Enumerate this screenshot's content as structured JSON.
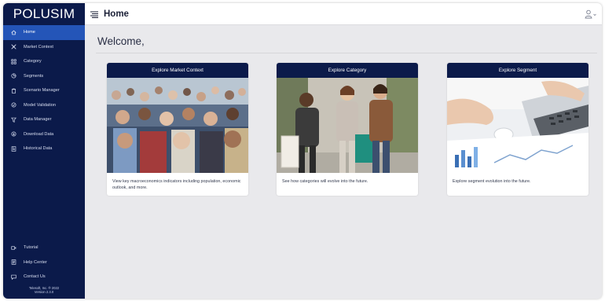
{
  "app": {
    "logo": "POLUSIM"
  },
  "header": {
    "title": "Home"
  },
  "sidebar": {
    "items": [
      {
        "label": "Home",
        "icon": "home-icon",
        "active": true
      },
      {
        "label": "Market Context",
        "icon": "market-icon"
      },
      {
        "label": "Category",
        "icon": "category-icon"
      },
      {
        "label": "Segments",
        "icon": "segments-icon"
      },
      {
        "label": "Scenario Manager",
        "icon": "scenario-icon"
      },
      {
        "label": "Model Validation",
        "icon": "validation-icon"
      },
      {
        "label": "Data Manager",
        "icon": "filter-icon"
      },
      {
        "label": "Download Data",
        "icon": "download-icon"
      },
      {
        "label": "Historical Data",
        "icon": "historical-icon"
      }
    ],
    "bottom": [
      {
        "label": "Tutorial",
        "icon": "video-icon"
      },
      {
        "label": "Help Center",
        "icon": "help-icon"
      },
      {
        "label": "Contact Us",
        "icon": "chat-icon"
      }
    ],
    "footer": {
      "copyright": "Telesoft, Inc. ® 2022",
      "version": "Version 2.3.0"
    }
  },
  "main": {
    "welcome": "Welcome,",
    "cards": [
      {
        "title": "Explore Market Context",
        "text": "View key macroeconomics indicators including population, economic outlook, and more."
      },
      {
        "title": "Explore Category",
        "text": "See how categories will evolve into the future."
      },
      {
        "title": "Explore Segment",
        "text": "Explore segment evolution into the future."
      }
    ]
  },
  "colors": {
    "sidebar": "#0b1a4a",
    "active": "#2455b8",
    "card_header": "#0b1a4a",
    "background": "#e9e9ec"
  }
}
